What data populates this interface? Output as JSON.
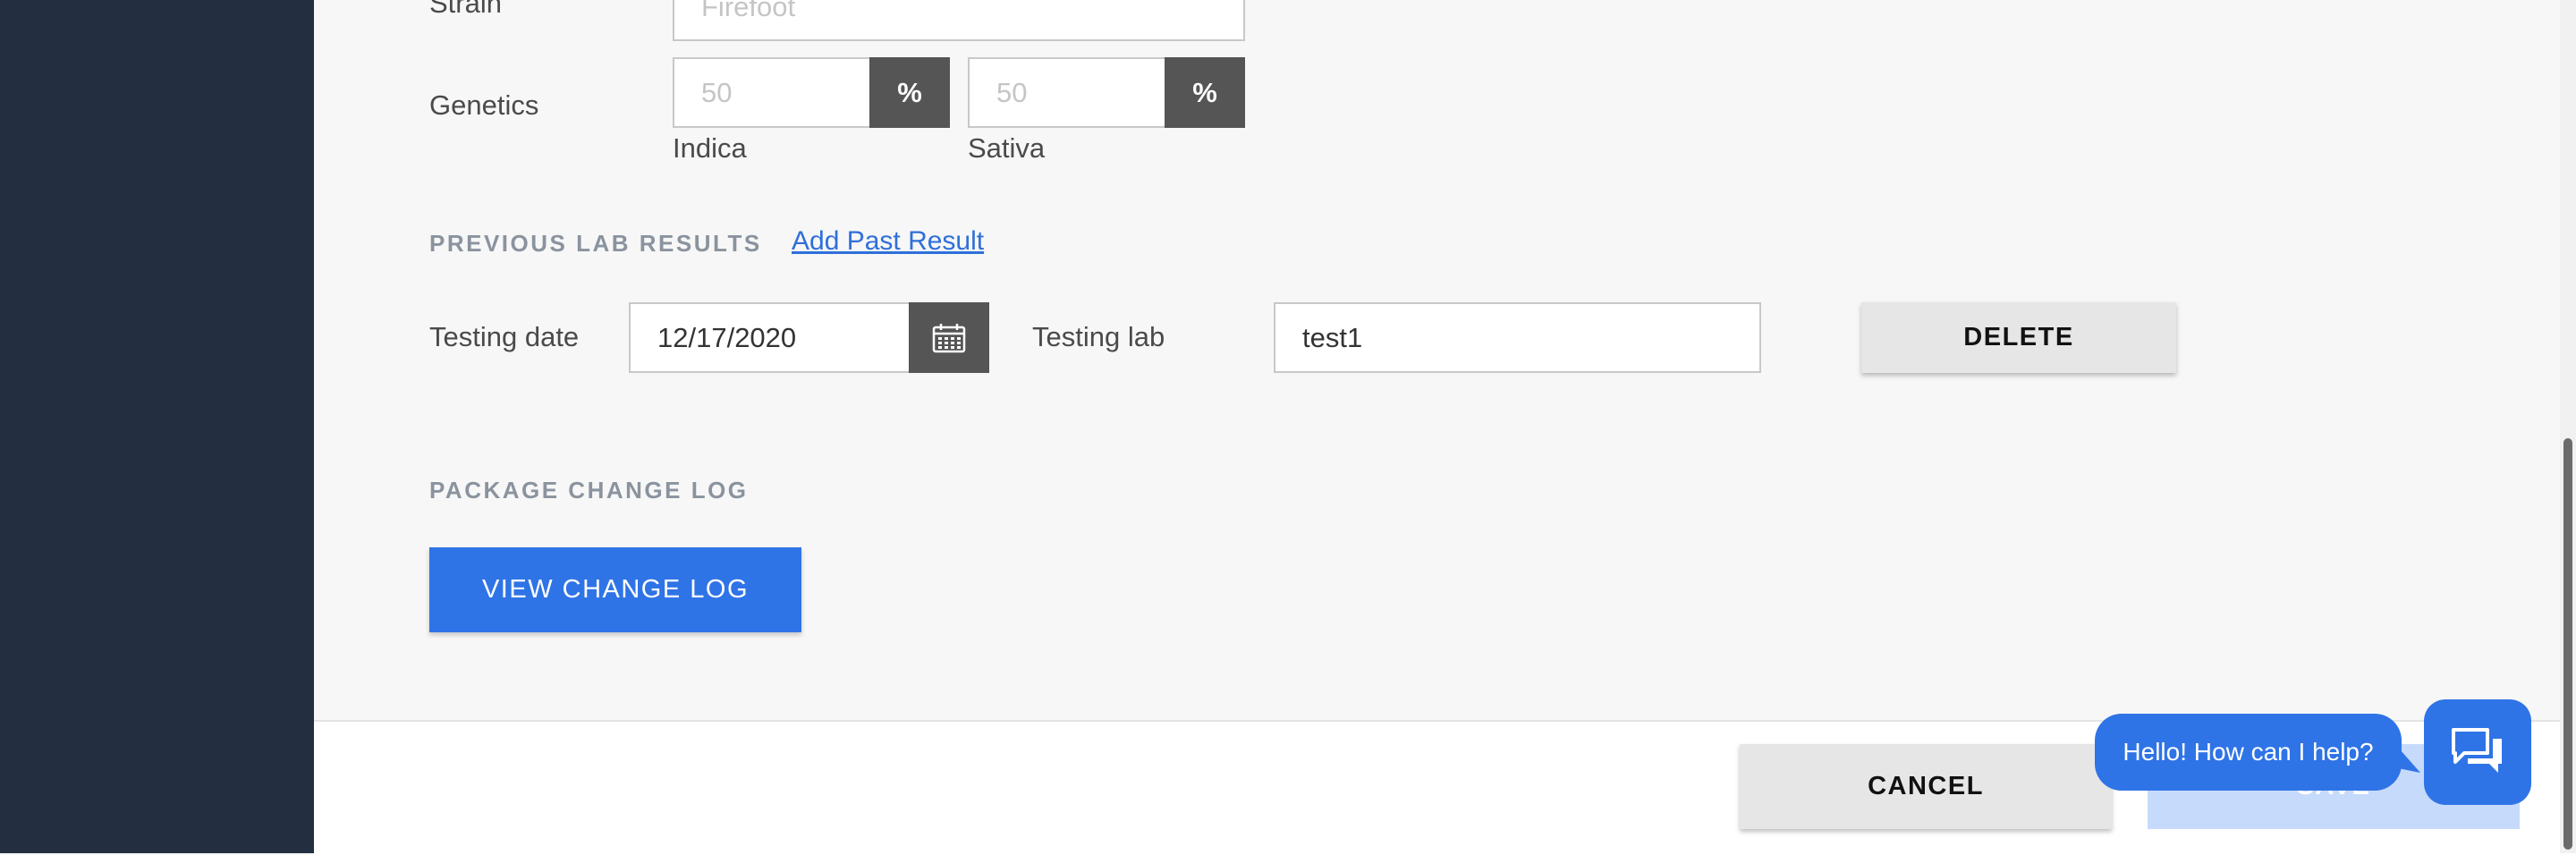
{
  "strain": {
    "label": "Strain",
    "placeholder": "Firefoot"
  },
  "genetics": {
    "label": "Genetics",
    "indica": {
      "placeholder": "50",
      "unit": "%",
      "label": "Indica"
    },
    "sativa": {
      "placeholder": "50",
      "unit": "%",
      "label": "Sativa"
    }
  },
  "previous_lab_results": {
    "heading": "PREVIOUS LAB RESULTS",
    "add_link": "Add Past Result",
    "testing_date_label": "Testing date",
    "testing_date_value": "12/17/2020",
    "testing_lab_label": "Testing lab",
    "testing_lab_value": "test1",
    "delete_label": "DELETE"
  },
  "package_change_log": {
    "heading": "PACKAGE CHANGE LOG",
    "view_label": "VIEW CHANGE LOG"
  },
  "footer": {
    "cancel_label": "CANCEL",
    "save_label": "SAVE"
  },
  "chat": {
    "greeting": "Hello! How can I help?"
  },
  "colors": {
    "sidebar": "#232f40",
    "primary": "#2f74e6",
    "addon": "#555555"
  }
}
